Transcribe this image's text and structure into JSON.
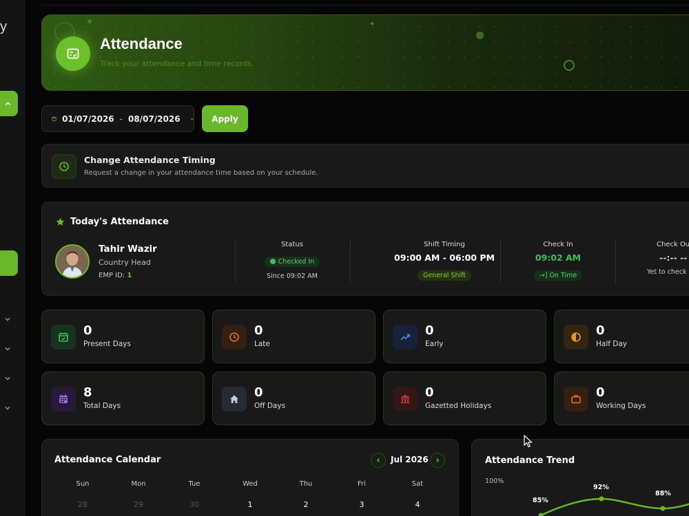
{
  "sidebar": {
    "brand_fragment": "y"
  },
  "header": {
    "title": "Attendance",
    "subtitle": "Track your attendance and time records."
  },
  "filter": {
    "start_date": "01/07/2026",
    "separator": "-",
    "end_date": "08/07/2026",
    "apply_label": "Apply"
  },
  "timing_request": {
    "title": "Change Attendance Timing",
    "description": "Request a change in your attendance time based on your schedule."
  },
  "today": {
    "heading": "Today's Attendance",
    "employee": {
      "name": "Tahir Wazir",
      "role": "Country Head",
      "id_label": "EMP ID:",
      "id_value": "1"
    },
    "status": {
      "label": "Status",
      "badge": "Checked In",
      "sub": "Since 09:02 AM"
    },
    "shift": {
      "label": "Shift Timing",
      "value": "09:00 AM - 06:00 PM",
      "badge": "General Shift"
    },
    "check_in": {
      "label": "Check In",
      "value": "09:02 AM",
      "badge": "On Time"
    },
    "check_out": {
      "label": "Check Out",
      "value": "--:-- --",
      "sub": "Yet to check out"
    }
  },
  "stats": [
    {
      "value": "0",
      "label": "Present Days",
      "icon": "calendar-check-icon",
      "color": "#3fbf5a",
      "bg": "#183220"
    },
    {
      "value": "0",
      "label": "Late",
      "icon": "clock-icon",
      "color": "#e0702a",
      "bg": "#33200f"
    },
    {
      "value": "0",
      "label": "Early",
      "icon": "trend-up-icon",
      "color": "#4a7fe0",
      "bg": "#172238"
    },
    {
      "value": "0",
      "label": "Half Day",
      "icon": "half-circle-icon",
      "color": "#e89a20",
      "bg": "#33250e"
    },
    {
      "value": "8",
      "label": "Total Days",
      "icon": "calendar-grid-icon",
      "color": "#9a6ae0",
      "bg": "#251a38"
    },
    {
      "value": "0",
      "label": "Off Days",
      "icon": "home-icon",
      "color": "#c8ccd4",
      "bg": "#262a32"
    },
    {
      "value": "0",
      "label": "Gazetted Holidays",
      "icon": "bank-icon",
      "color": "#d23a3a",
      "bg": "#331616"
    },
    {
      "value": "0",
      "label": "Working Days",
      "icon": "briefcase-icon",
      "color": "#e0702a",
      "bg": "#33200f"
    }
  ],
  "calendar": {
    "title": "Attendance Calendar",
    "month": "Jul 2026",
    "weekdays": [
      "Sun",
      "Mon",
      "Tue",
      "Wed",
      "Thu",
      "Fri",
      "Sat"
    ],
    "first_row": [
      "28",
      "29",
      "30",
      "1",
      "2",
      "3",
      "4"
    ]
  },
  "trend": {
    "title": "Attendance Trend",
    "y_max_label": "100%",
    "points": [
      "85%",
      "92%",
      "88%"
    ]
  },
  "colors": {
    "accent": "#6ab82a",
    "background": "#060606",
    "card": "#191919"
  }
}
